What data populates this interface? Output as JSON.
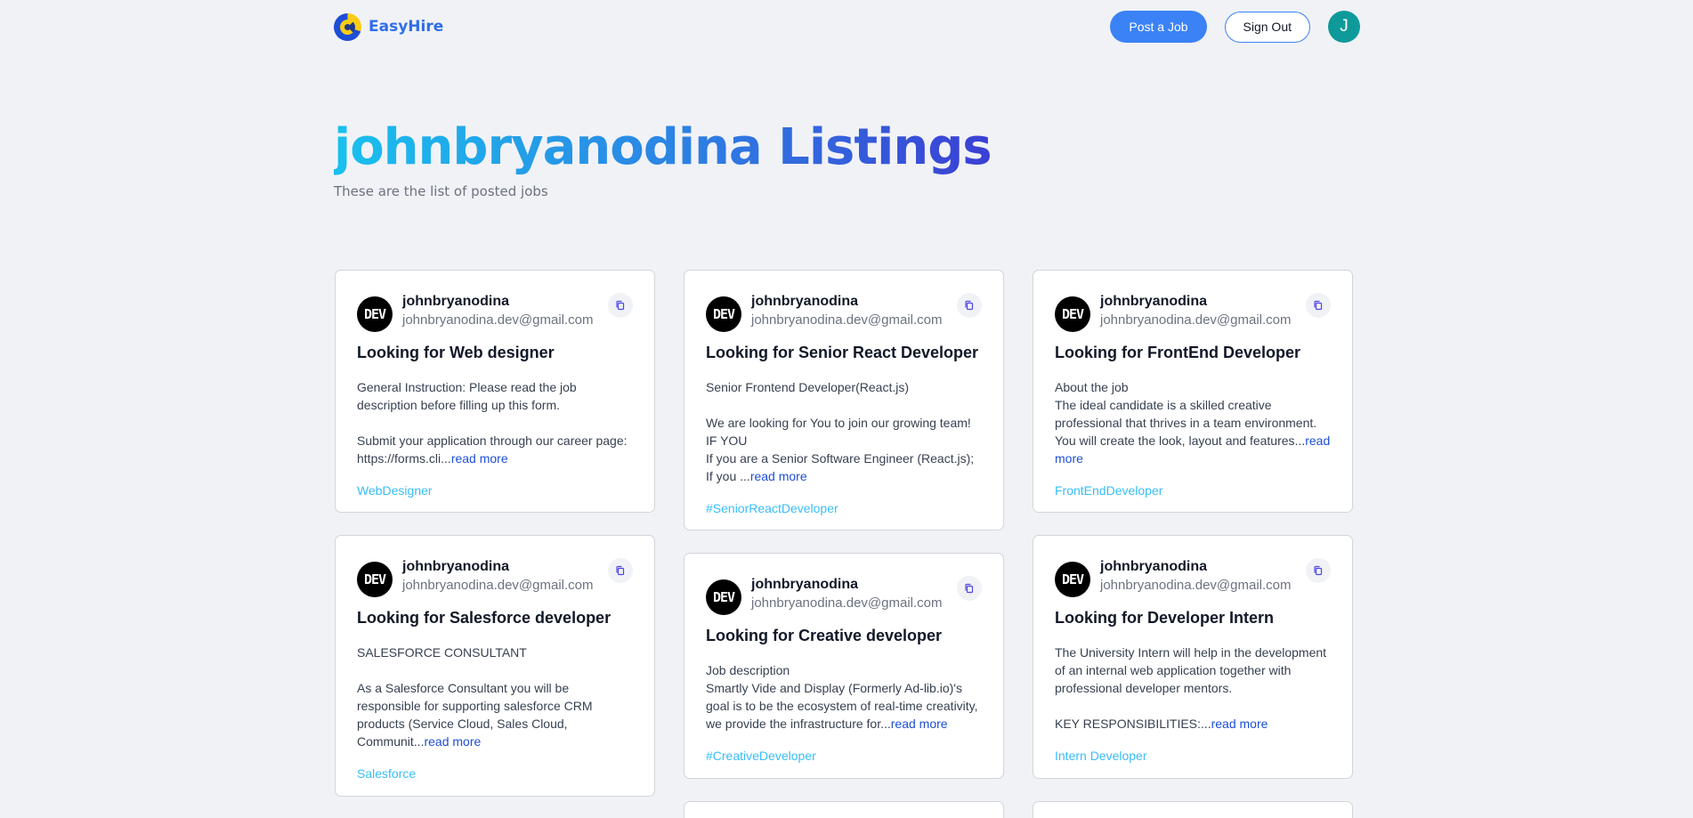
{
  "header": {
    "brand": "EasyHire",
    "post_job": "Post a Job",
    "sign_out": "Sign Out",
    "avatar_initial": "J"
  },
  "page": {
    "title": "johnbryanodina Listings",
    "subtitle": "These are the list of posted jobs"
  },
  "cards": [
    {
      "author": "johnbryanodina",
      "email": "johnbryanodina.dev@gmail.com",
      "logo": "DEV",
      "title": "Looking for Web designer",
      "lines": [
        "General Instruction: Please read the job",
        "description before filling up this form.",
        "",
        "Submit your application through our career page:",
        "https://forms.cli..."
      ],
      "read_more": "read more",
      "tag": "WebDesigner"
    },
    {
      "author": "johnbryanodina",
      "email": "johnbryanodina.dev@gmail.com",
      "logo": "DEV",
      "title": "Looking for Senior React Developer",
      "lines": [
        "Senior Frontend Developer(React.js)",
        "",
        "We are looking for You to join our growing team!",
        "IF YOU",
        "If you are a Senior Software Engineer (React.js);",
        "If you ..."
      ],
      "read_more": "read more",
      "tag": "#SeniorReactDeveloper"
    },
    {
      "author": "johnbryanodina",
      "email": "johnbryanodina.dev@gmail.com",
      "logo": "DEV",
      "title": "Looking for FrontEnd Developer",
      "lines": [
        "About the job",
        "The ideal candidate is a skilled creative",
        "professional that thrives in a team environment.",
        "You will create the look, layout and features...",
        ""
      ],
      "read_more": "read more",
      "tag": "FrontEndDeveloper"
    },
    {
      "author": "johnbryanodina",
      "email": "johnbryanodina.dev@gmail.com",
      "logo": "DEV",
      "title": "Looking for Salesforce developer",
      "lines": [
        "SALESFORCE CONSULTANT",
        "",
        "As a Salesforce Consultant you will be",
        "responsible for supporting salesforce CRM",
        "products (Service Cloud, Sales Cloud,",
        "Communit..."
      ],
      "read_more": "read more",
      "tag": "Salesforce"
    },
    {
      "author": "johnbryanodina",
      "email": "johnbryanodina.dev@gmail.com",
      "logo": "DEV",
      "title": "Looking for Creative developer",
      "lines": [
        "Job description",
        "Smartly Vide and Display (Formerly Ad-lib.io)'s",
        "goal is to be the ecosystem of real-time creativity,",
        "we provide the infrastructure for..."
      ],
      "read_more": "read more",
      "tag": "#CreativeDeveloper"
    },
    {
      "author": "johnbryanodina",
      "email": "johnbryanodina.dev@gmail.com",
      "logo": "DEV",
      "title": "Looking for Developer Intern",
      "lines": [
        "The University Intern will help in the development",
        "of an internal web application together with",
        "professional developer mentors.",
        "",
        "KEY RESPONSIBILITIES:..."
      ],
      "read_more": "read more",
      "tag": "Intern Developer"
    }
  ]
}
